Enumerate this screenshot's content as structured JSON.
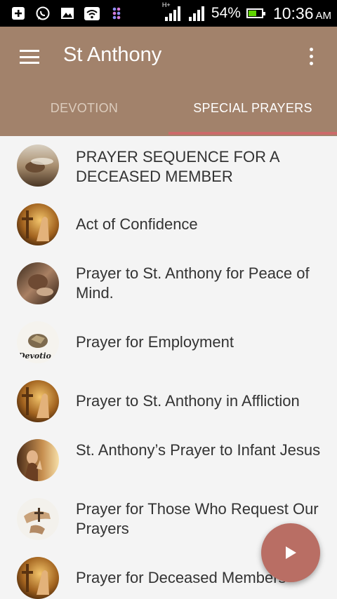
{
  "status_bar": {
    "network": "H+",
    "battery_percent": "54%",
    "time": "10:36",
    "ampm": "AM",
    "battery_level": 0.54,
    "icons": [
      "add-box-icon",
      "whatsapp-icon",
      "gallery-icon",
      "wifi-icon",
      "app-icon",
      "signal-icon",
      "signal-icon",
      "battery-icon"
    ]
  },
  "app_bar": {
    "title": "St Anthony",
    "menu_icon": "hamburger-menu-icon",
    "overflow_icon": "more-vert-icon"
  },
  "tabs": [
    {
      "label": "DEVOTION",
      "selected": false
    },
    {
      "label": "SPECIAL PRAYERS",
      "selected": true
    }
  ],
  "colors": {
    "app_bar": "#a2826b",
    "tab_indicator": "#cc6a6a",
    "fab": "#b96e64",
    "background": "#f4f4f4"
  },
  "prayers": [
    {
      "title": "PRAYER SEQUENCE FOR A DECEASED MEMBER"
    },
    {
      "title": "Act of Confidence"
    },
    {
      "title": "Prayer to St. Anthony for Peace of Mind."
    },
    {
      "title": "Prayer for Employment",
      "image_text": "Devotio"
    },
    {
      "title": "Prayer to St. Anthony in Affliction"
    },
    {
      "title": "St. Anthony’s Prayer to Infant Jesus"
    },
    {
      "title": "Prayer for Those Who Request Our Prayers"
    },
    {
      "title": "Prayer for Deceased Members"
    }
  ],
  "fab": {
    "icon": "play-icon"
  }
}
